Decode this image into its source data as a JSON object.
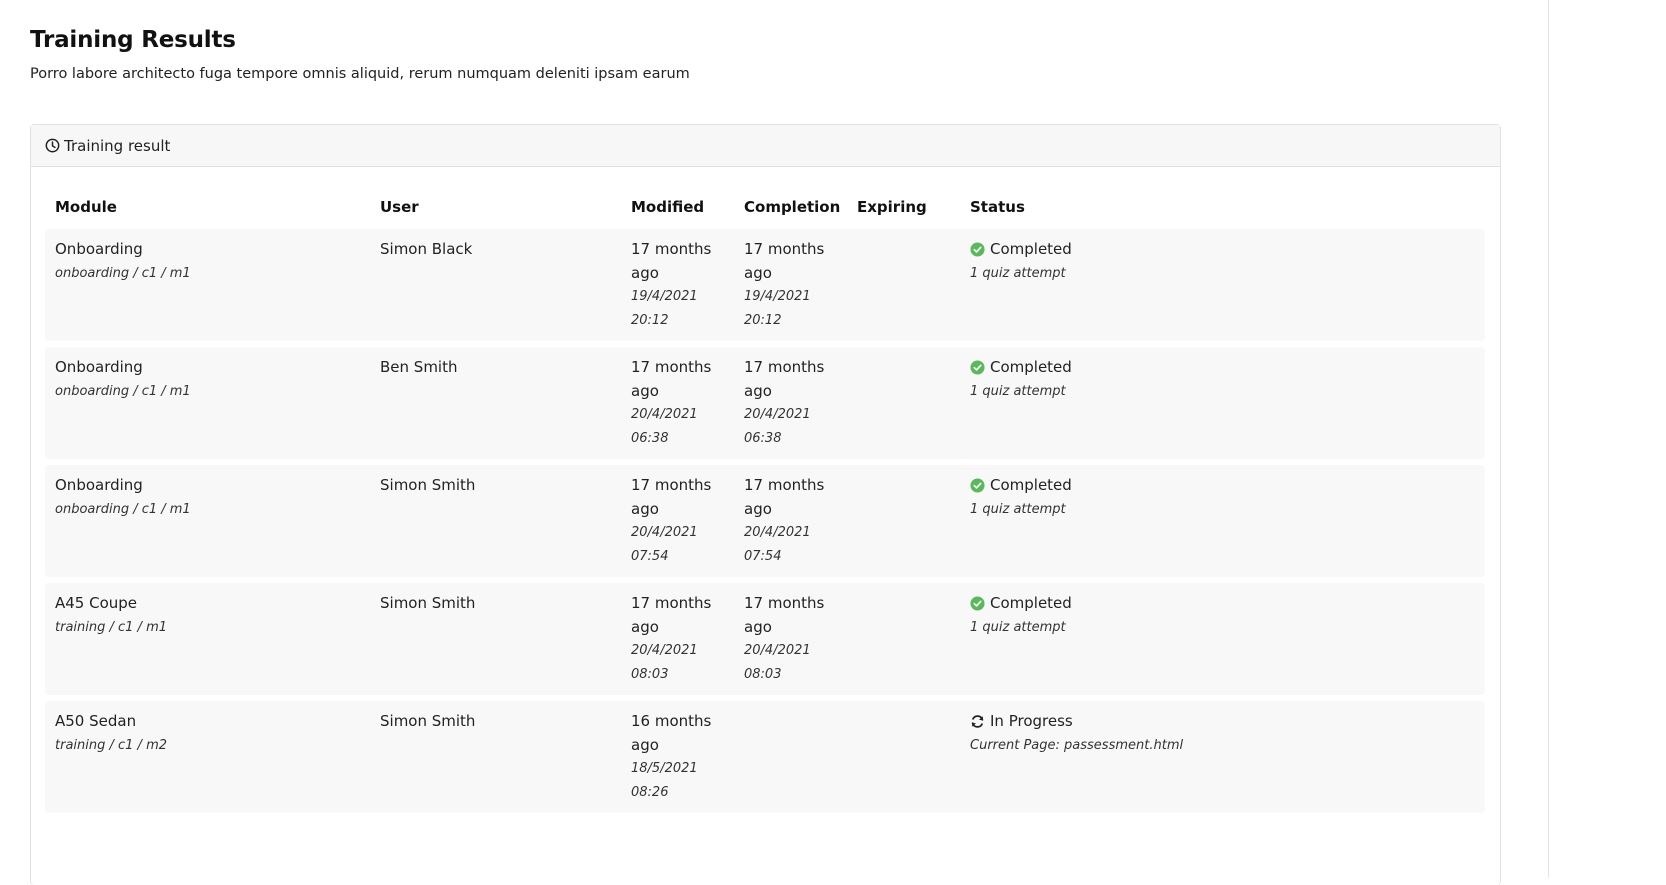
{
  "page": {
    "title": "Training Results",
    "subtitle": "Porro labore architecto fuga tempore omnis aliquid, rerum numquam deleniti ipsam earum"
  },
  "card": {
    "header_icon": "clock-icon",
    "header_label": "Training result"
  },
  "table": {
    "columns": [
      "Module",
      "User",
      "Modified",
      "Completion",
      "Expiring",
      "Status"
    ],
    "rows": [
      {
        "module": "Onboarding",
        "module_path": "onboarding / c1 / m1",
        "user": "Simon Black",
        "modified": "17 months ago",
        "modified_date": "19/4/2021 20:12",
        "completion": "17 months ago",
        "completion_date": "19/4/2021 20:12",
        "expiring": "",
        "status": "Completed",
        "status_icon": "check-circle-icon",
        "status_detail": "1 quiz attempt"
      },
      {
        "module": "Onboarding",
        "module_path": "onboarding / c1 / m1",
        "user": "Ben Smith",
        "modified": "17 months ago",
        "modified_date": "20/4/2021 06:38",
        "completion": "17 months ago",
        "completion_date": "20/4/2021 06:38",
        "expiring": "",
        "status": "Completed",
        "status_icon": "check-circle-icon",
        "status_detail": "1 quiz attempt"
      },
      {
        "module": "Onboarding",
        "module_path": "onboarding / c1 / m1",
        "user": "Simon Smith",
        "modified": "17 months ago",
        "modified_date": "20/4/2021 07:54",
        "completion": "17 months ago",
        "completion_date": "20/4/2021 07:54",
        "expiring": "",
        "status": "Completed",
        "status_icon": "check-circle-icon",
        "status_detail": "1 quiz attempt"
      },
      {
        "module": "A45 Coupe",
        "module_path": "training / c1 / m1",
        "user": "Simon Smith",
        "modified": "17 months ago",
        "modified_date": "20/4/2021 08:03",
        "completion": "17 months ago",
        "completion_date": "20/4/2021 08:03",
        "expiring": "",
        "status": "Completed",
        "status_icon": "check-circle-icon",
        "status_detail": "1 quiz attempt"
      },
      {
        "module": "A50 Sedan",
        "module_path": "training / c1 / m2",
        "user": "Simon Smith",
        "modified": "16 months ago",
        "modified_date": "18/5/2021 08:26",
        "completion": "",
        "completion_date": "",
        "expiring": "",
        "status": "In Progress",
        "status_icon": "sync-icon",
        "status_detail": "Current Page: passessment.html"
      }
    ]
  },
  "colors": {
    "completed": "#5cb85c",
    "in_progress": "#222222",
    "row_bg": "#f8f8f8",
    "header_bg": "#f7f7f7"
  }
}
